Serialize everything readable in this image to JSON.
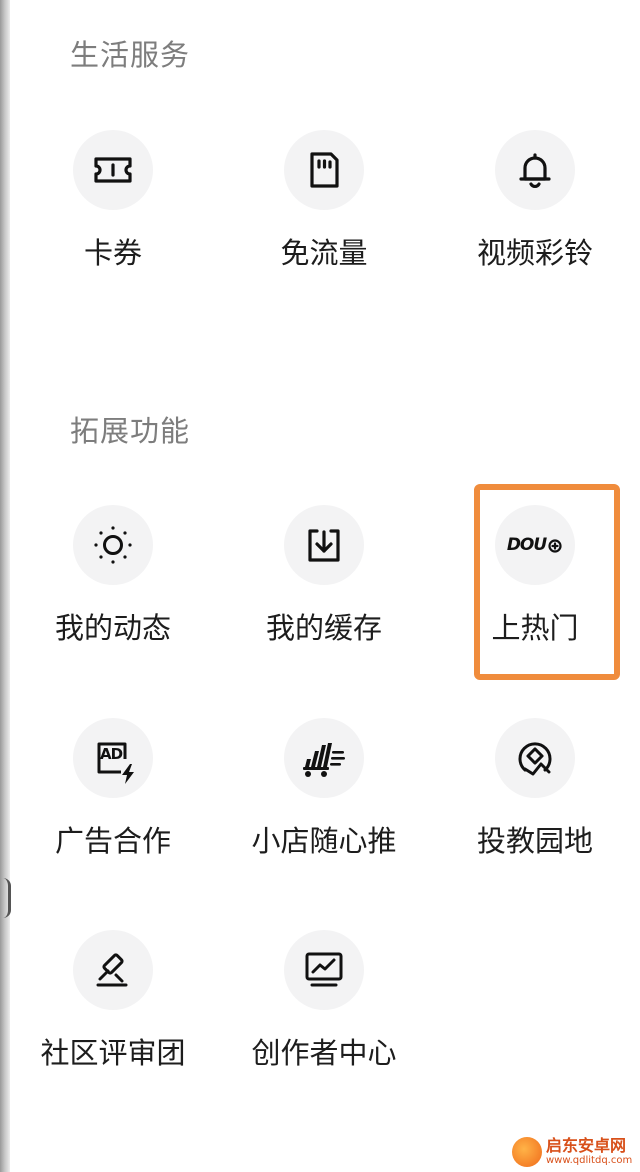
{
  "sections": {
    "life": {
      "title": "生活服务"
    },
    "extend": {
      "title": "拓展功能"
    }
  },
  "tiles": {
    "coupons": {
      "label": "卡券",
      "icon": "ticket-icon"
    },
    "free_data": {
      "label": "免流量",
      "icon": "sim-card-icon"
    },
    "ringtone": {
      "label": "视频彩铃",
      "icon": "bell-icon"
    },
    "my_moments": {
      "label": "我的动态",
      "icon": "sun-icon"
    },
    "my_cache": {
      "label": "我的缓存",
      "icon": "download-icon"
    },
    "doujia": {
      "label": "上热门",
      "icon": "dou-plus-icon",
      "badge_text": "DOU"
    },
    "ad_coop": {
      "label": "广告合作",
      "icon": "ad-icon",
      "badge_text": "AD"
    },
    "shop_push": {
      "label": "小店随心推",
      "icon": "shop-cart-icon"
    },
    "invest_garden": {
      "label": "投教园地",
      "icon": "compass-icon"
    },
    "review_team": {
      "label": "社区评审团",
      "icon": "gavel-icon"
    },
    "creator_center": {
      "label": "创作者中心",
      "icon": "monitor-chart-icon"
    }
  },
  "watermark": {
    "name": "启东安卓网",
    "url": "www.qdlitdq.com"
  },
  "colors": {
    "highlight_border": "#f08c3c",
    "icon_bg": "#f3f3f4",
    "label_text": "#1d1d1d",
    "section_title": "#7d7d7d"
  }
}
